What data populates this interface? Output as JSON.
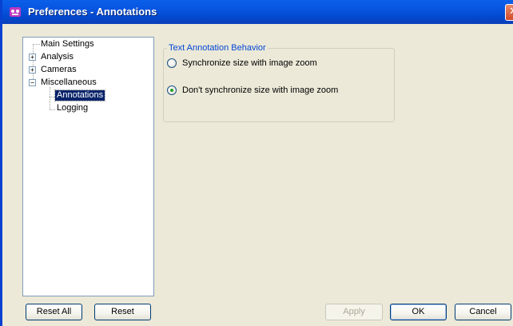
{
  "window": {
    "title": "Preferences - Annotations",
    "close_glyph": "✕"
  },
  "tree": {
    "items": [
      {
        "label": "Main Settings",
        "expandable": false,
        "selected": false
      },
      {
        "label": "Analysis",
        "expandable": true,
        "expanded": false,
        "expander": "+",
        "selected": false
      },
      {
        "label": "Cameras",
        "expandable": true,
        "expanded": false,
        "expander": "+",
        "selected": false
      },
      {
        "label": "Miscellaneous",
        "expandable": true,
        "expanded": true,
        "expander": "−",
        "selected": false
      },
      {
        "label": "Annotations",
        "expandable": false,
        "selected": true
      },
      {
        "label": "Logging",
        "expandable": false,
        "selected": false
      }
    ]
  },
  "group": {
    "title": "Text Annotation Behavior",
    "options": [
      {
        "label": "Synchronize size with image zoom",
        "checked": false
      },
      {
        "label": "Don't synchronize size with image zoom",
        "checked": true
      }
    ]
  },
  "buttons": {
    "reset_all": "Reset All",
    "reset": "Reset",
    "apply": "Apply",
    "ok": "OK",
    "cancel": "Cancel"
  },
  "colors": {
    "title_bar": "#0a5fe8",
    "selection": "#0a246a",
    "group_title": "#0046d5",
    "radio_dot": "#21a121"
  }
}
